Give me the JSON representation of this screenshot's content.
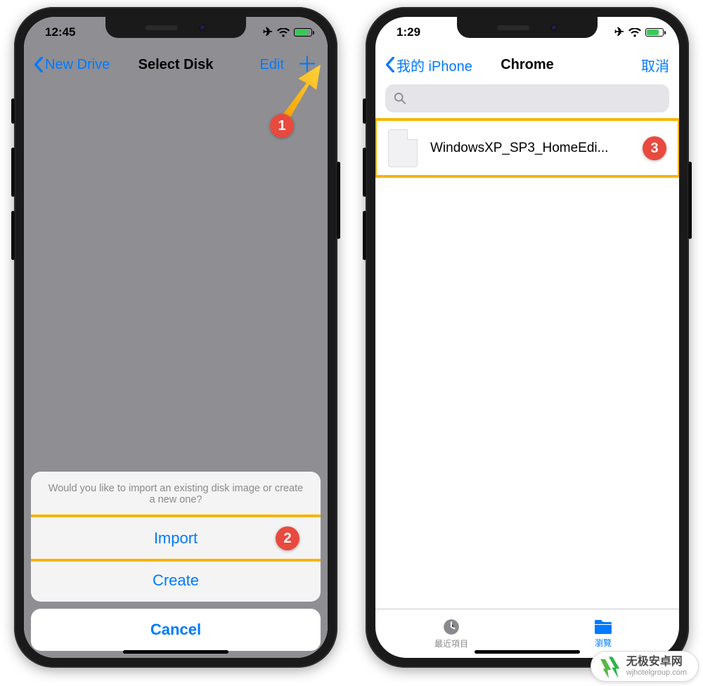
{
  "left": {
    "status": {
      "time": "12:45"
    },
    "nav": {
      "back": "New Drive",
      "title": "Select Disk",
      "edit": "Edit"
    },
    "actionsheet": {
      "message": "Would you like to import an existing disk image or create a new one?",
      "import": "Import",
      "create": "Create",
      "cancel": "Cancel"
    },
    "callouts": {
      "one": "1",
      "two": "2"
    }
  },
  "right": {
    "status": {
      "time": "1:29"
    },
    "nav": {
      "back": "我的 iPhone",
      "title": "Chrome",
      "cancel": "取消"
    },
    "search": {
      "placeholder": ""
    },
    "file": {
      "name": "WindowsXP_SP3_HomeEdi..."
    },
    "tabs": {
      "recents": "最近項目",
      "browse": "瀏覽"
    },
    "callouts": {
      "three": "3"
    }
  },
  "watermark": {
    "brand": "无极安卓网",
    "url": "wjhotelgroup.com"
  }
}
